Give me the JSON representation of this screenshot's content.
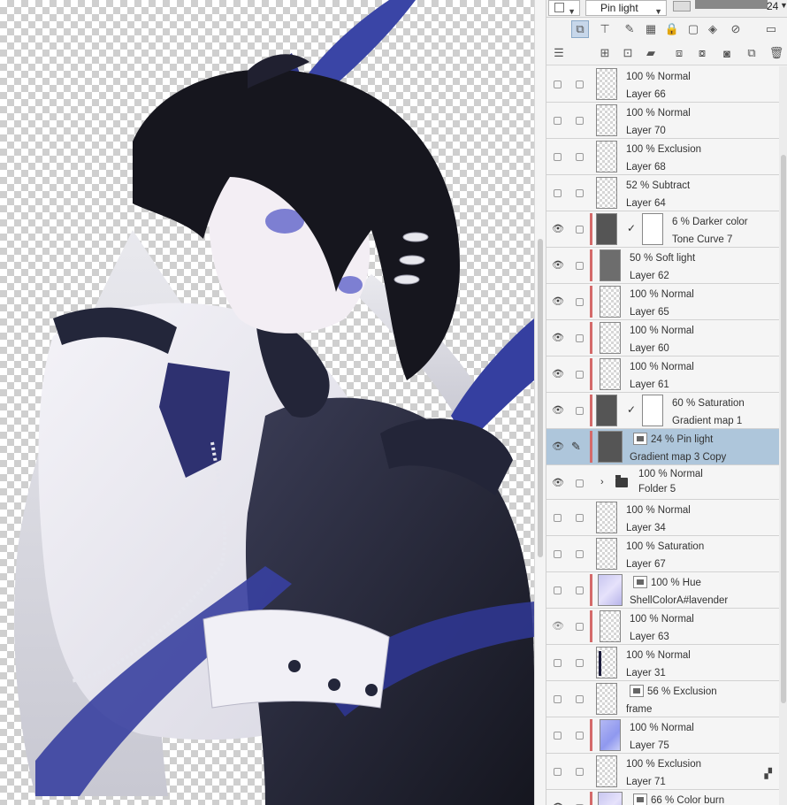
{
  "toolbar": {
    "blend_mode": "Pin light",
    "opacity": "24"
  },
  "layers": [
    {
      "mode": "100 % Normal",
      "name": "Layer 66",
      "visible": false,
      "type": "raster"
    },
    {
      "mode": "100 % Normal",
      "name": "Layer 70",
      "visible": false,
      "type": "raster"
    },
    {
      "mode": "100 % Exclusion",
      "name": "Layer 68",
      "visible": false,
      "type": "raster"
    },
    {
      "mode": "52 % Subtract",
      "name": "Layer 64",
      "visible": false,
      "type": "raster"
    },
    {
      "mode": "6 % Darker color",
      "name": "Tone Curve 7",
      "visible": true,
      "type": "correction"
    },
    {
      "mode": "50 % Soft light",
      "name": "Layer 62",
      "visible": true,
      "type": "gray"
    },
    {
      "mode": "100 % Normal",
      "name": "Layer 65",
      "visible": true,
      "type": "raster"
    },
    {
      "mode": "100 % Normal",
      "name": "Layer 60",
      "visible": true,
      "type": "raster"
    },
    {
      "mode": "100 % Normal",
      "name": "Layer 61",
      "visible": true,
      "type": "raster"
    },
    {
      "mode": "60 % Saturation",
      "name": "Gradient map 1",
      "visible": true,
      "type": "correction"
    },
    {
      "mode": "24 % Pin light",
      "name": "Gradient map 3 Copy",
      "visible": true,
      "type": "selected"
    },
    {
      "mode": "100 % Normal",
      "name": "Folder 5",
      "visible": true,
      "type": "folder"
    },
    {
      "mode": "100 % Normal",
      "name": "Layer 34",
      "visible": false,
      "type": "raster"
    },
    {
      "mode": "100 % Saturation",
      "name": "Layer 67",
      "visible": false,
      "type": "raster"
    },
    {
      "mode": "100 % Hue",
      "name": "ShellColorA#lavender",
      "visible": false,
      "type": "lavender"
    },
    {
      "mode": "100 % Normal",
      "name": "Layer 63",
      "visible": true,
      "type": "raster"
    },
    {
      "mode": "100 % Normal",
      "name": "Layer 31",
      "visible": false,
      "type": "stripe"
    },
    {
      "mode": "56 % Exclusion",
      "name": "frame",
      "visible": false,
      "type": "frame"
    },
    {
      "mode": "100 % Normal",
      "name": "Layer 75",
      "visible": false,
      "type": "blue"
    },
    {
      "mode": "100 % Exclusion",
      "name": "Layer 71",
      "visible": false,
      "type": "raster"
    },
    {
      "mode": "66 % Color burn",
      "name": "",
      "visible": true,
      "type": "lavender"
    }
  ]
}
